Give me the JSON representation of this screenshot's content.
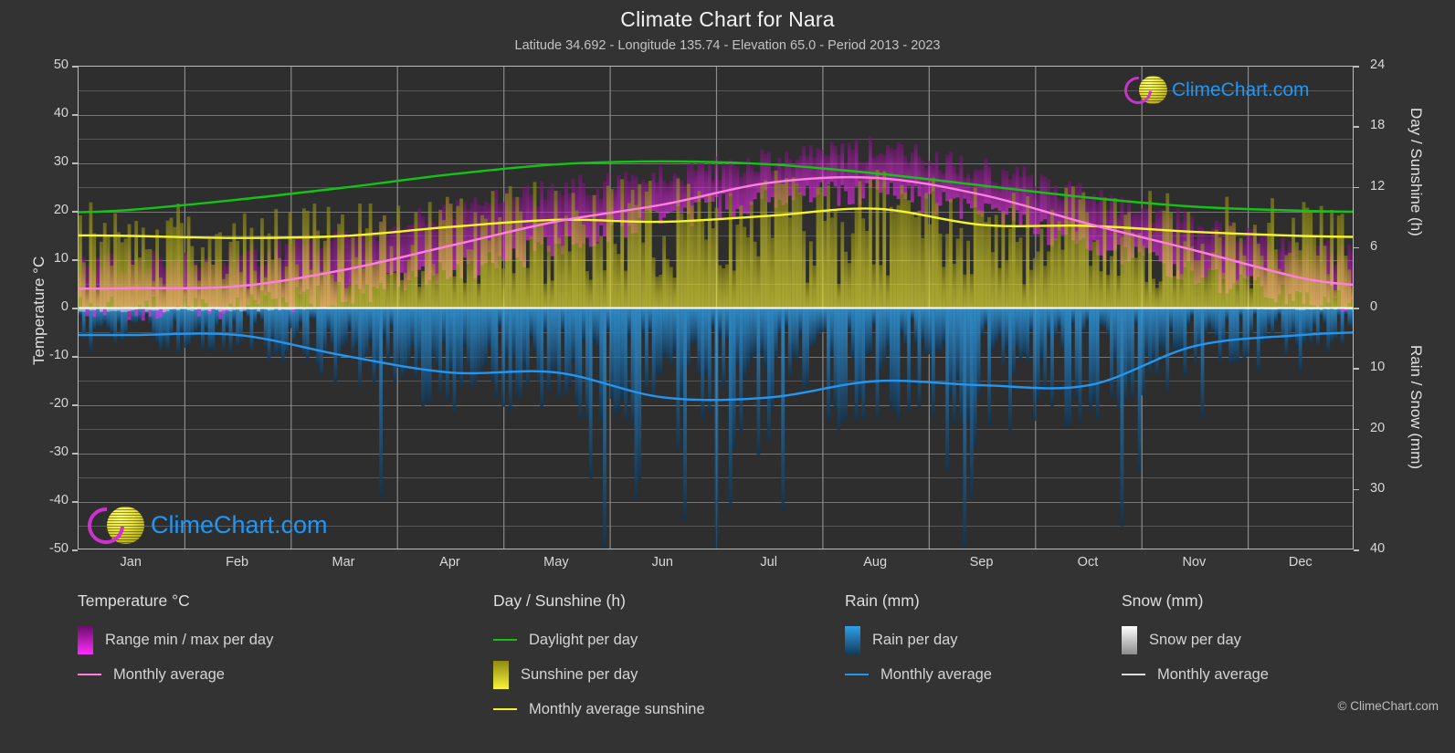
{
  "header": {
    "title": "Climate Chart for Nara",
    "subtitle": "Latitude 34.692 - Longitude 135.74 - Elevation 65.0 - Period 2013 - 2023"
  },
  "watermark": {
    "text": "ClimeChart.com"
  },
  "footer": {
    "copyright": "© ClimeChart.com"
  },
  "axes": {
    "left": {
      "title": "Temperature °C",
      "ticks": [
        "50",
        "40",
        "30",
        "20",
        "10",
        "0",
        "-10",
        "-20",
        "-30",
        "-40",
        "-50"
      ]
    },
    "right_top": {
      "title": "Day / Sunshine (h)",
      "ticks": [
        "24",
        "18",
        "12",
        "6",
        "0"
      ]
    },
    "right_bottom": {
      "title": "Rain / Snow (mm)",
      "ticks": [
        "0",
        "10",
        "20",
        "30",
        "40"
      ]
    },
    "x": {
      "ticks": [
        "Jan",
        "Feb",
        "Mar",
        "Apr",
        "May",
        "Jun",
        "Jul",
        "Aug",
        "Sep",
        "Oct",
        "Nov",
        "Dec"
      ]
    }
  },
  "legend": {
    "columns": [
      {
        "title": "Temperature °C",
        "items": [
          {
            "label": "Range min / max per day",
            "marker": "gradient-swatch",
            "color": "#ff00ff"
          },
          {
            "label": "Monthly average",
            "marker": "line",
            "color": "#ff7fe0"
          }
        ]
      },
      {
        "title": "Day / Sunshine (h)",
        "items": [
          {
            "label": "Daylight per day",
            "marker": "line",
            "color": "#14c414"
          },
          {
            "label": "Sunshine per day",
            "marker": "gradient-swatch",
            "color": "#f2f230"
          },
          {
            "label": "Monthly average sunshine",
            "marker": "line",
            "color": "#f2f230"
          }
        ]
      },
      {
        "title": "Rain (mm)",
        "items": [
          {
            "label": "Rain per day",
            "marker": "gradient-swatch",
            "color": "#1e90f0"
          },
          {
            "label": "Monthly average",
            "marker": "line",
            "color": "#2196f3"
          }
        ]
      },
      {
        "title": "Snow (mm)",
        "items": [
          {
            "label": "Snow per day",
            "marker": "gradient-swatch",
            "color": "#ffffff"
          },
          {
            "label": "Monthly average",
            "marker": "line",
            "color": "#dddddd"
          }
        ]
      }
    ]
  },
  "colors": {
    "background": "#333333",
    "plot_background": "#2e2e2e",
    "grid": "#6d6d6d",
    "axis": "#bcbcbc",
    "zero_line": "#ffffff",
    "temperature_range": "#ff00ff",
    "temperature_avg": "#ff7fe0",
    "daylight": "#14c414",
    "sunshine": "#e8e320",
    "sunshine_avg": "#f5f52a",
    "rain": "#1e88e0",
    "rain_avg": "#2196f3",
    "snow": "#e8e8e8",
    "logo_text": "#2196f3",
    "logo_arc": "#cc33cc"
  },
  "chart_data": {
    "type": "line",
    "title": "Climate Chart for Nara",
    "subtitle": "Latitude 34.692 - Longitude 135.74 - Elevation 65.0 - Period 2013 - 2023",
    "xlabel": "",
    "ylabel": "Temperature °C",
    "ylim": [
      -50,
      50
    ],
    "y2lim_top": [
      0,
      24
    ],
    "y2lim_bottom": [
      0,
      40
    ],
    "grid": true,
    "legend_position": "below",
    "categories": [
      "Jan",
      "Feb",
      "Mar",
      "Apr",
      "May",
      "Jun",
      "Jul",
      "Aug",
      "Sep",
      "Oct",
      "Nov",
      "Dec"
    ],
    "series": [
      {
        "name": "Monthly average",
        "unit": "°C",
        "axis": "left",
        "color": "#ff7fe0",
        "values": [
          4.2,
          4.6,
          8.0,
          13.0,
          18.0,
          21.5,
          26.0,
          27.0,
          23.5,
          17.5,
          12.0,
          6.3
        ]
      },
      {
        "name": "Daylight per day",
        "unit": "h",
        "axis": "right_top",
        "color": "#14c414",
        "values": [
          9.8,
          10.8,
          12.0,
          13.3,
          14.3,
          14.6,
          14.3,
          13.4,
          12.2,
          11.0,
          10.1,
          9.7
        ]
      },
      {
        "name": "Monthly average sunshine",
        "unit": "h",
        "axis": "right_top",
        "color": "#f5f52a",
        "values": [
          7.2,
          7.0,
          7.2,
          8.1,
          8.8,
          8.6,
          9.2,
          9.9,
          8.3,
          8.2,
          7.6,
          7.2
        ]
      },
      {
        "name": "Rain monthly average",
        "unit": "mm",
        "axis": "right_bottom",
        "color": "#2196f3",
        "values": [
          4.4,
          4.4,
          7.8,
          10.6,
          10.6,
          14.7,
          14.7,
          12.0,
          12.7,
          12.7,
          6.2,
          4.4
        ]
      },
      {
        "name": "Temperature range min / max per day",
        "unit": "°C",
        "axis": "left",
        "color": "#ff00ff",
        "min_values": [
          0.0,
          0.5,
          3.0,
          7.5,
          13.0,
          18.5,
          23.0,
          24.0,
          20.0,
          13.0,
          7.0,
          2.0
        ],
        "max_values": [
          9.5,
          10.5,
          14.5,
          20.0,
          24.5,
          27.0,
          31.0,
          33.0,
          29.0,
          23.0,
          17.0,
          11.5
        ]
      },
      {
        "name": "Sunshine per day",
        "unit": "h",
        "axis": "right_top",
        "color": "#e8e320",
        "values": [
          7.2,
          7.0,
          7.2,
          8.1,
          8.8,
          8.6,
          9.2,
          9.9,
          8.3,
          8.2,
          7.6,
          7.2
        ]
      },
      {
        "name": "Rain per day",
        "unit": "mm",
        "axis": "right_bottom",
        "color": "#1e88e0",
        "values": [
          4.4,
          4.4,
          7.8,
          10.6,
          10.6,
          14.7,
          14.7,
          12.0,
          12.7,
          12.7,
          6.2,
          4.4
        ]
      },
      {
        "name": "Snow per day",
        "unit": "mm",
        "axis": "right_bottom",
        "color": "#e8e8e8",
        "values": [
          0.2,
          0.2,
          0.0,
          0.0,
          0.0,
          0.0,
          0.0,
          0.0,
          0.0,
          0.0,
          0.0,
          0.1
        ]
      }
    ]
  }
}
